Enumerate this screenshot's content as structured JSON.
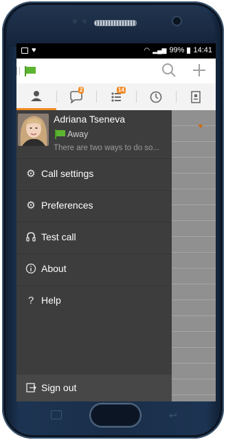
{
  "statusbar": {
    "battery": "99%",
    "time": "14:41"
  },
  "appbar": {
    "presence_icon": "green-flag-icon",
    "search_icon": "search-icon",
    "add_icon": "plus-icon"
  },
  "tabs": [
    {
      "name": "contacts",
      "icon": "person-icon",
      "badge": ""
    },
    {
      "name": "chats",
      "icon": "chat-bubble-icon",
      "badge": "2"
    },
    {
      "name": "activity",
      "icon": "feed-icon",
      "badge": "14"
    },
    {
      "name": "history",
      "icon": "clock-icon",
      "badge": ""
    },
    {
      "name": "meetings",
      "icon": "meeting-room-icon",
      "badge": ""
    }
  ],
  "profile": {
    "name": "Adriana Tseneva",
    "status": "Away",
    "note": "There are two ways to do so..."
  },
  "menu": {
    "call_settings": "Call settings",
    "preferences": "Preferences",
    "test_call": "Test call",
    "about": "About",
    "help": "Help",
    "sign_out": "Sign out"
  },
  "colors": {
    "accent": "#f08a24",
    "presence_green": "#5cb531",
    "drawer_bg": "#3d3d3d"
  }
}
